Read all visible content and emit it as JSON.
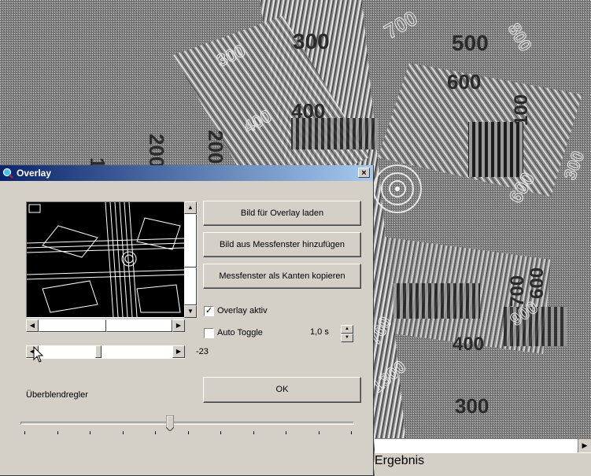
{
  "background": {
    "numbers": [
      "300",
      "500",
      "600",
      "700",
      "800",
      "400",
      "100",
      "200",
      "1000",
      "1300",
      "300",
      "600",
      "900",
      "400",
      "100",
      "300",
      "600",
      "700",
      "300",
      "400"
    ]
  },
  "result_label": "Ergebnis",
  "dialog": {
    "title": "Overlay",
    "buttons": {
      "load_overlay": "Bild für Overlay laden",
      "add_from_window": "Bild aus Messfenster hinzufügen",
      "copy_edges": "Messfenster als Kanten kopieren",
      "ok": "OK"
    },
    "overlay_active": {
      "label": "Overlay aktiv",
      "checked": true
    },
    "auto_toggle": {
      "label": "Auto Toggle",
      "checked": false
    },
    "toggle_interval": "1,0 s",
    "offset_value": "-23",
    "blend_label": "Überblendregler",
    "blend_position": 0.46,
    "close_glyph": "×"
  }
}
